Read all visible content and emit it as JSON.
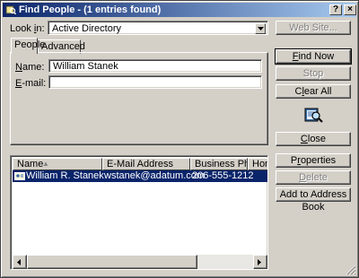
{
  "window": {
    "title": "Find People - (1 entries found)",
    "help_button": "?",
    "close_button": "×"
  },
  "look_in": {
    "label_prefix": "Look ",
    "label_accel": "i",
    "label_suffix": "n:",
    "value": "Active Directory"
  },
  "buttons": {
    "web_site": "Web Site...",
    "find_now_accel": "F",
    "find_now_rest": "ind Now",
    "stop": "Stop",
    "clear_all_prefix": "C",
    "clear_all_accel": "l",
    "clear_all_suffix": "ear All",
    "close_accel": "C",
    "close_rest": "lose",
    "properties_prefix": "P",
    "properties_accel": "r",
    "properties_suffix": "operties",
    "delete_accel": "D",
    "delete_rest": "elete",
    "add_to_address_book": "Add to Address Book"
  },
  "tabs": [
    {
      "label": "People",
      "active": true
    },
    {
      "label": "Advanced",
      "active": false
    }
  ],
  "people_tab": {
    "name_label_accel": "N",
    "name_label_rest": "ame:",
    "name_value": "William Stanek",
    "email_label_accel": "E",
    "email_label_rest": "-mail:",
    "email_value": ""
  },
  "results": {
    "columns": [
      "Name",
      "E-Mail Address",
      "Business Phone",
      "Home"
    ],
    "sort_indicator": "▲",
    "rows": [
      {
        "name": "William R. Stanek",
        "email": "wstanek@adatum.com",
        "business_phone": "206-555-1212",
        "home": "",
        "selected": true
      }
    ]
  },
  "colors": {
    "selection": "#0a246a",
    "title_start": "#0a246a",
    "title_end": "#a6caf0",
    "face": "#d4d0c8"
  }
}
